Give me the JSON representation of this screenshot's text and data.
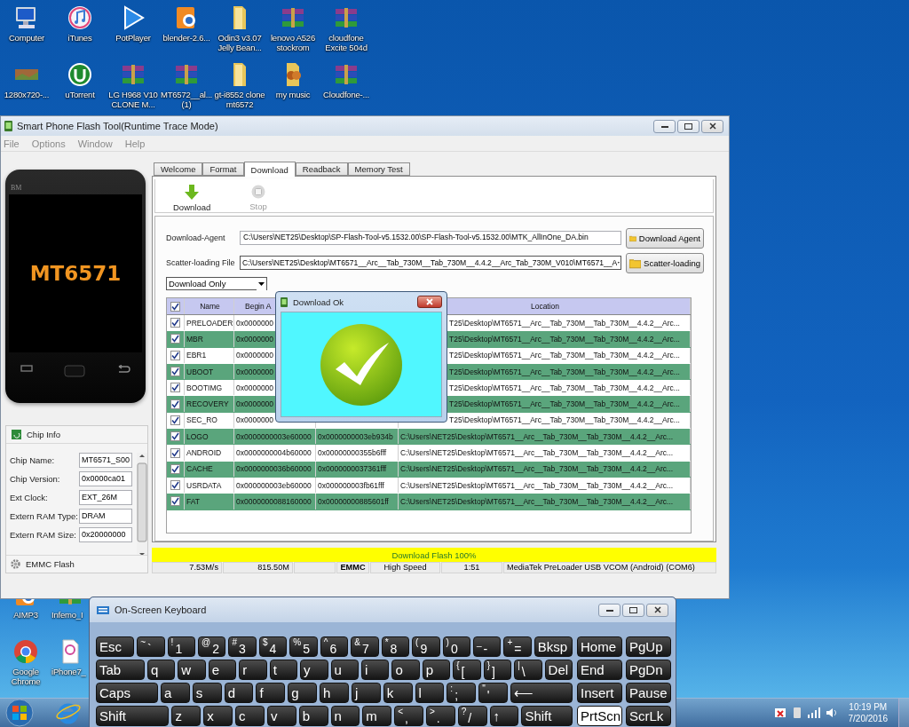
{
  "desktop_icons": [
    {
      "label": "Computer",
      "kind": "monitor"
    },
    {
      "label": "iTunes",
      "kind": "music"
    },
    {
      "label": "PotPlayer",
      "kind": "play"
    },
    {
      "label": "blender-2.6...",
      "kind": "app"
    },
    {
      "label": "Odin3 v3.07 Jelly Bean...",
      "kind": "folder"
    },
    {
      "label": "lenovo A526 stockrom",
      "kind": "archive"
    },
    {
      "label": "cloudfone Excite 504d",
      "kind": "archive"
    },
    {
      "label": "1280x720-...",
      "kind": "image"
    },
    {
      "label": "uTorrent",
      "kind": "torrent"
    },
    {
      "label": "LG H968 V10 CLONE M...",
      "kind": "archive"
    },
    {
      "label": "MT6572__al... (1)",
      "kind": "archive"
    },
    {
      "label": "gt-i8552 clone mt6572",
      "kind": "folder"
    },
    {
      "label": "my music",
      "kind": "musicfolder"
    },
    {
      "label": "Cloudfone-...",
      "kind": "archive"
    }
  ],
  "desktop_icons_lower": [
    {
      "label": "AIMP3",
      "kind": "app"
    },
    {
      "label": "Infemo_I",
      "kind": "archive"
    },
    {
      "label": "Google Chrome",
      "kind": "browser"
    },
    {
      "label": "iPhone7_",
      "kind": "document"
    }
  ],
  "flash_tool": {
    "title": "Smart Phone Flash Tool(Runtime Trace Mode)",
    "menu": [
      "File",
      "Options",
      "Window",
      "Help"
    ],
    "phone": {
      "brand": "BM",
      "chip": "MT6571"
    },
    "chip_info": {
      "title": "Chip Info",
      "fields": [
        {
          "label": "Chip Name:",
          "value": "MT6571_S00"
        },
        {
          "label": "Chip Version:",
          "value": "0x0000ca01"
        },
        {
          "label": "Ext Clock:",
          "value": "EXT_26M"
        },
        {
          "label": "Extern RAM Type:",
          "value": "DRAM"
        },
        {
          "label": "Extern RAM Size:",
          "value": "0x20000000"
        }
      ],
      "footer": "EMMC Flash"
    },
    "tabs": [
      {
        "label": "Welcome",
        "selected": false
      },
      {
        "label": "Format",
        "selected": false
      },
      {
        "label": "Download",
        "selected": true
      },
      {
        "label": "Readback",
        "selected": false
      },
      {
        "label": "Memory Test",
        "selected": false
      }
    ],
    "toolbar": [
      {
        "label": "Download",
        "kind": "download",
        "disabled": false
      },
      {
        "label": "Stop",
        "kind": "stop",
        "disabled": true
      }
    ],
    "download_agent": {
      "label": "Download-Agent",
      "value": "C:\\Users\\NET25\\Desktop\\SP-Flash-Tool-v5.1532.00\\SP-Flash-Tool-v5.1532.00\\MTK_AllInOne_DA.bin",
      "button": "Download Agent"
    },
    "scatter": {
      "label": "Scatter-loading File",
      "value": "C:\\Users\\NET25\\Desktop\\MT6571__Arc__Tab_730M__Tab_730M__4.4.2__Arc_Tab_730M_V010\\MT6571__A",
      "button": "Scatter-loading"
    },
    "mode": "Download Only",
    "table": {
      "all_checked": true,
      "columns": {
        "name": "Name",
        "begin": "Begin A",
        "location": "Location"
      },
      "rows": [
        {
          "checked": true,
          "name": "PRELOADER",
          "begin": "0x0000000",
          "location": "T25\\Desktop\\MT6571__Arc__Tab_730M__Tab_730M__4.4.2__Arc..."
        },
        {
          "checked": true,
          "name": "MBR",
          "begin": "0x0000000",
          "location": "T25\\Desktop\\MT6571__Arc__Tab_730M__Tab_730M__4.4.2__Arc..."
        },
        {
          "checked": true,
          "name": "EBR1",
          "begin": "0x0000000",
          "location": "T25\\Desktop\\MT6571__Arc__Tab_730M__Tab_730M__4.4.2__Arc..."
        },
        {
          "checked": true,
          "name": "UBOOT",
          "begin": "0x0000000",
          "location": "T25\\Desktop\\MT6571__Arc__Tab_730M__Tab_730M__4.4.2__Arc..."
        },
        {
          "checked": true,
          "name": "BOOTIMG",
          "begin": "0x0000000",
          "location": "T25\\Desktop\\MT6571__Arc__Tab_730M__Tab_730M__4.4.2__Arc..."
        },
        {
          "checked": true,
          "name": "RECOVERY",
          "begin": "0x0000000",
          "location": "T25\\Desktop\\MT6571__Arc__Tab_730M__Tab_730M__4.4.2__Arc..."
        },
        {
          "checked": true,
          "name": "SEC_RO",
          "begin": "0x0000000",
          "location": "T25\\Desktop\\MT6571__Arc__Tab_730M__Tab_730M__4.4.2__Arc..."
        },
        {
          "checked": true,
          "name": "LOGO",
          "begin": "0x0000000003e60000",
          "end": "0x0000000003eb934b",
          "location": "C:\\Users\\NET25\\Desktop\\MT6571__Arc__Tab_730M__Tab_730M__4.4.2__Arc..."
        },
        {
          "checked": true,
          "name": "ANDROID",
          "begin": "0x0000000004b60000",
          "end": "0x00000000355b6fff",
          "location": "C:\\Users\\NET25\\Desktop\\MT6571__Arc__Tab_730M__Tab_730M__4.4.2__Arc..."
        },
        {
          "checked": true,
          "name": "CACHE",
          "begin": "0x0000000036b60000",
          "end": "0x0000000037361fff",
          "location": "C:\\Users\\NET25\\Desktop\\MT6571__Arc__Tab_730M__Tab_730M__4.4.2__Arc..."
        },
        {
          "checked": true,
          "name": "USRDATA",
          "begin": "0x000000003eb60000",
          "end": "0x000000003fb61fff",
          "location": "C:\\Users\\NET25\\Desktop\\MT6571__Arc__Tab_730M__Tab_730M__4.4.2__Arc..."
        },
        {
          "checked": true,
          "name": "FAT",
          "begin": "0x0000000088160000",
          "end": "0x00000000885601ff",
          "location": "C:\\Users\\NET25\\Desktop\\MT6571__Arc__Tab_730M__Tab_730M__4.4.2__Arc..."
        }
      ]
    },
    "progress": {
      "label": "Download Flash 100%",
      "level": 1
    },
    "status": {
      "speed": "7.53M/s",
      "size": "815.50M",
      "storage": "EMMC",
      "mode": "High Speed",
      "time": "1:51",
      "port": "MediaTek PreLoader USB VCOM (Android) (COM6)"
    }
  },
  "dialog": {
    "title": "Download Ok"
  },
  "keyboard": {
    "title": "On-Screen Keyboard",
    "rows": [
      {
        "main": [
          {
            "kind": "mid",
            "main": "Esc",
            "pressed": false
          },
          {
            "kind": "std",
            "top": "~",
            "main": "`",
            "pressed": false
          },
          {
            "kind": "std",
            "top": "!",
            "main": "1",
            "pressed": false
          },
          {
            "kind": "std",
            "top": "@",
            "main": "2",
            "pressed": false
          },
          {
            "kind": "std",
            "top": "#",
            "main": "3",
            "pressed": false
          },
          {
            "kind": "std",
            "top": "$",
            "main": "4",
            "pressed": false
          },
          {
            "kind": "std",
            "top": "%",
            "main": "5",
            "pressed": false
          },
          {
            "kind": "std",
            "top": "^",
            "main": "6",
            "pressed": false
          },
          {
            "kind": "std",
            "top": "&",
            "main": "7",
            "pressed": false
          },
          {
            "kind": "std",
            "top": "*",
            "main": "8",
            "pressed": false
          },
          {
            "kind": "std",
            "top": "(",
            "main": "9",
            "pressed": false
          },
          {
            "kind": "std",
            "top": ")",
            "main": "0",
            "pressed": false
          },
          {
            "kind": "std",
            "top": "_",
            "main": "-",
            "pressed": false
          },
          {
            "kind": "std",
            "top": "+",
            "main": "=",
            "pressed": false
          },
          {
            "kind": "mid",
            "main": "Bksp",
            "pressed": false
          }
        ],
        "nav": [
          {
            "kind": "nav",
            "main": "Home",
            "pressed": false
          },
          {
            "kind": "nav",
            "main": "PgUp",
            "pressed": false
          }
        ]
      },
      {
        "main": [
          {
            "kind": "wide",
            "main": "Tab",
            "pressed": false
          },
          {
            "kind": "std",
            "main": "q",
            "pressed": false
          },
          {
            "kind": "std",
            "main": "w",
            "pressed": false
          },
          {
            "kind": "std",
            "main": "e",
            "pressed": false
          },
          {
            "kind": "std",
            "main": "r",
            "pressed": false
          },
          {
            "kind": "std",
            "main": "t",
            "pressed": false
          },
          {
            "kind": "std",
            "main": "y",
            "pressed": false
          },
          {
            "kind": "std",
            "main": "u",
            "pressed": false
          },
          {
            "kind": "std",
            "main": "i",
            "pressed": false
          },
          {
            "kind": "std",
            "main": "o",
            "pressed": false
          },
          {
            "kind": "std",
            "main": "p",
            "pressed": false
          },
          {
            "kind": "std",
            "top": "{",
            "main": "[",
            "pressed": false
          },
          {
            "kind": "std",
            "top": "}",
            "main": "]",
            "pressed": false
          },
          {
            "kind": "std",
            "top": "|",
            "main": "\\",
            "pressed": false
          },
          {
            "kind": "std",
            "main": "Del",
            "pressed": false
          }
        ],
        "nav": [
          {
            "kind": "nav",
            "main": "End",
            "pressed": false
          },
          {
            "kind": "nav",
            "main": "PgDn",
            "pressed": false
          }
        ]
      },
      {
        "main": [
          {
            "kind": "xwide",
            "main": "Caps",
            "pressed": false
          },
          {
            "kind": "std",
            "main": "a",
            "pressed": false
          },
          {
            "kind": "std",
            "main": "s",
            "pressed": false
          },
          {
            "kind": "std",
            "main": "d",
            "pressed": false
          },
          {
            "kind": "std",
            "main": "f",
            "pressed": false
          },
          {
            "kind": "std",
            "main": "g",
            "pressed": false
          },
          {
            "kind": "std",
            "main": "h",
            "pressed": false
          },
          {
            "kind": "std",
            "main": "j",
            "pressed": false
          },
          {
            "kind": "std",
            "main": "k",
            "pressed": false
          },
          {
            "kind": "std",
            "main": "l",
            "pressed": false
          },
          {
            "kind": "std",
            "top": ":",
            "main": ";",
            "pressed": false
          },
          {
            "kind": "std",
            "top": "\"",
            "main": "'",
            "pressed": false
          },
          {
            "kind": "xwide",
            "main": "⟵",
            "pressed": false
          }
        ],
        "nav": [
          {
            "kind": "nav",
            "main": "Insert",
            "pressed": false
          },
          {
            "kind": "nav",
            "main": "Pause",
            "pressed": false
          }
        ]
      },
      {
        "main": [
          {
            "kind": "xxwide",
            "main": "Shift",
            "pressed": false
          },
          {
            "kind": "std",
            "main": "z",
            "pressed": false
          },
          {
            "kind": "std",
            "main": "x",
            "pressed": false
          },
          {
            "kind": "std",
            "main": "c",
            "pressed": false
          },
          {
            "kind": "std",
            "main": "v",
            "pressed": false
          },
          {
            "kind": "std",
            "main": "b",
            "pressed": false
          },
          {
            "kind": "std",
            "main": "n",
            "pressed": false
          },
          {
            "kind": "std",
            "main": "m",
            "pressed": false
          },
          {
            "kind": "std",
            "top": "<",
            "main": ",",
            "pressed": false
          },
          {
            "kind": "std",
            "top": ">",
            "main": ".",
            "pressed": false
          },
          {
            "kind": "std",
            "top": "?",
            "main": "/",
            "pressed": false
          },
          {
            "kind": "std",
            "main": "↑",
            "pressed": false
          },
          {
            "kind": "wide",
            "main": "Shift",
            "pressed": false
          }
        ],
        "nav": [
          {
            "kind": "nav",
            "main": "PrtScn",
            "pressed": true
          },
          {
            "kind": "nav",
            "main": "ScrLk",
            "pressed": false
          }
        ]
      }
    ]
  },
  "taskbar": {
    "time": "10:19 PM",
    "date": "7/20/2016"
  }
}
